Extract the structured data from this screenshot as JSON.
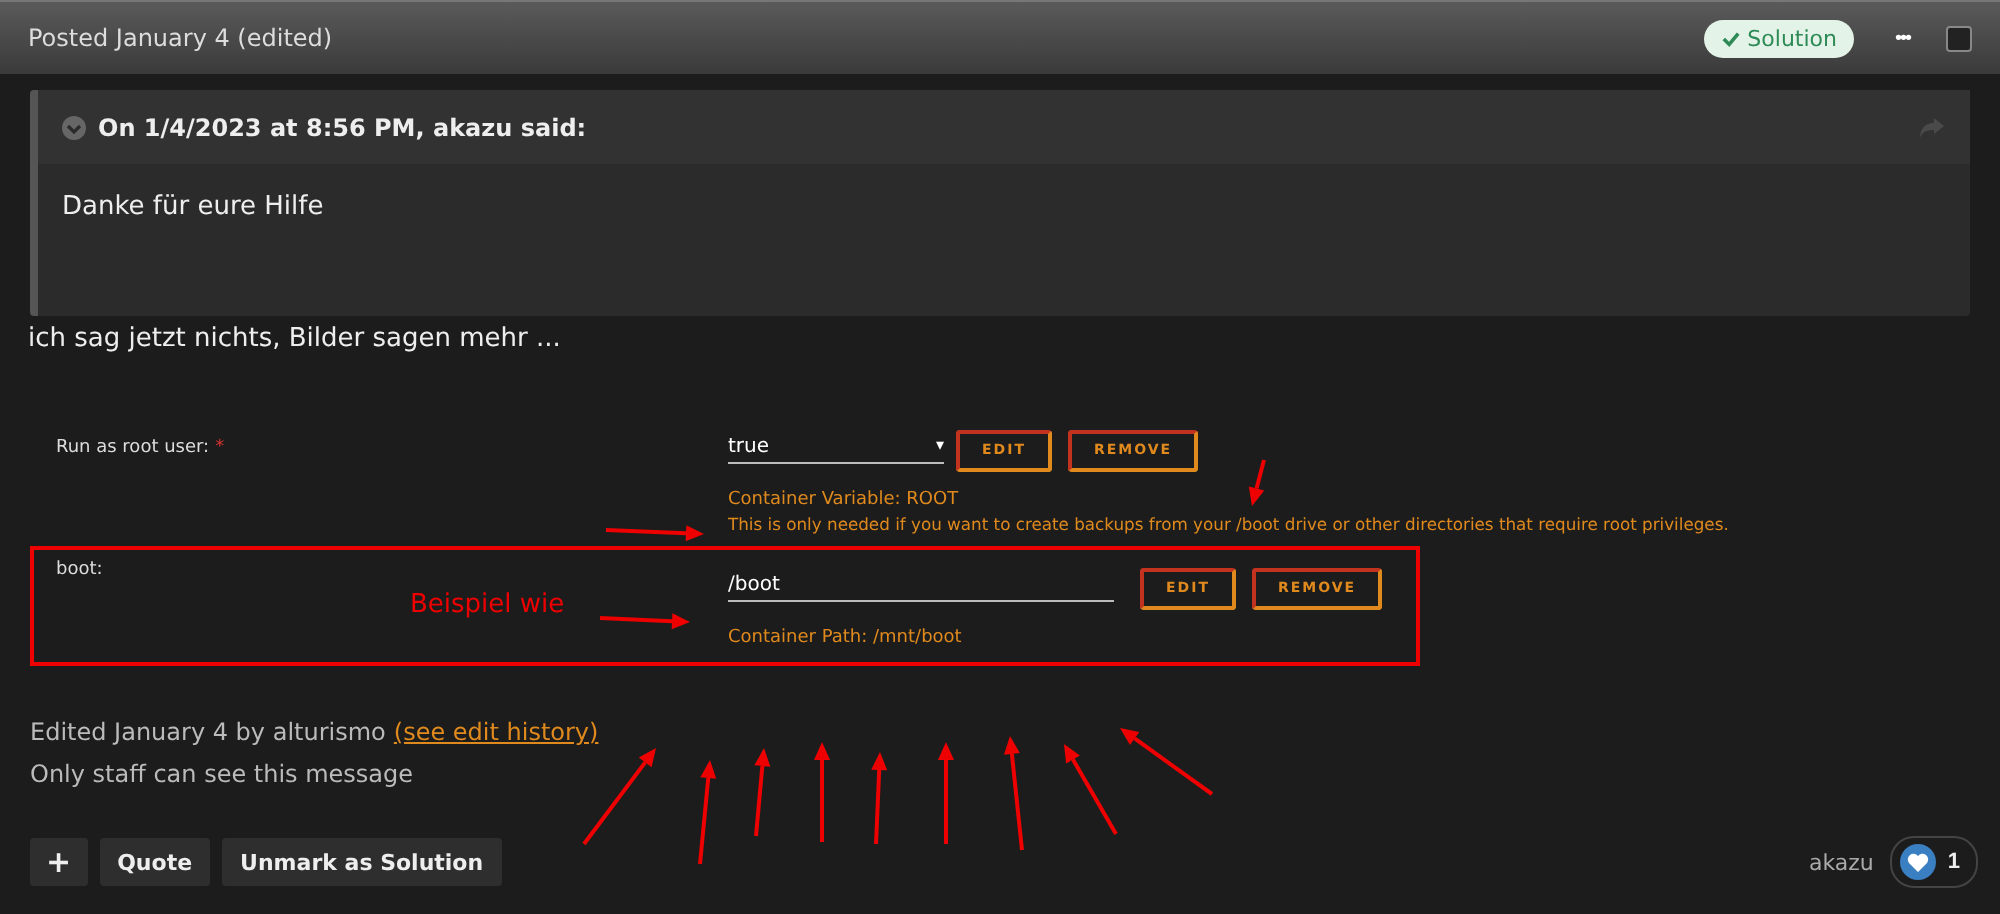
{
  "post_header": {
    "posted": "Posted January 4 (edited)",
    "solution_badge": "Solution",
    "more": "•••",
    "selected": false
  },
  "quote": {
    "citation": "On 1/4/2023 at 8:56 PM, akazu said:",
    "text": "Danke für eure Hilfe"
  },
  "body_text": "ich sag jetzt nichts, Bilder sagen mehr ...",
  "embedded_screenshot": {
    "root_row": {
      "label": "Run as root user:",
      "required_mark": "*",
      "select_value": "true",
      "select_caret": "▾",
      "edit": "EDIT",
      "remove": "REMOVE",
      "variable": "Container Variable: ROOT",
      "description": "This is only needed if you want to create backups from your /boot drive or other directories that require root privileges."
    },
    "boot_row": {
      "label": "boot:",
      "annotation": "Beispiel wie",
      "value": "/boot",
      "edit": "EDIT",
      "remove": "REMOVE",
      "path": "Container Path: /mnt/boot"
    }
  },
  "edited": {
    "text": "Edited January 4 by alturismo",
    "link": "(see edit history)"
  },
  "staff_note": "Only staff can see this message",
  "actions": [
    {
      "kind": "plus",
      "label": "+"
    },
    {
      "kind": "text",
      "label": "Quote"
    },
    {
      "kind": "text",
      "label": "Unmark as Solution"
    }
  ],
  "reaction": {
    "user": "akazu",
    "count": "1"
  }
}
